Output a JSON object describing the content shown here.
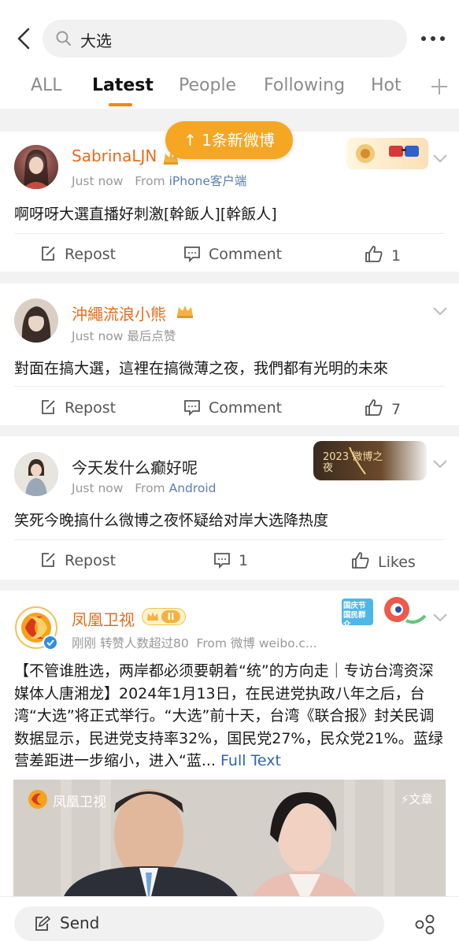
{
  "search": {
    "query": "大选"
  },
  "tabs": [
    {
      "label": "ALL"
    },
    {
      "label": "Latest"
    },
    {
      "label": "People"
    },
    {
      "label": "Following"
    },
    {
      "label": "Hot"
    }
  ],
  "new_posts_pill": "1条新微博",
  "posts": [
    {
      "username": "SabrinaLJN",
      "time": "Just now",
      "from_prefix": "From",
      "source": "iPhone客户端",
      "text": "啊呀呀大選直播好刺激[幹飯人][幹飯人]",
      "repost": "Repost",
      "comment": "Comment",
      "likes": "1"
    },
    {
      "username": "沖繩流浪小熊",
      "time": "Just now",
      "extra": "最后点赞",
      "text": "對面在搞大選，這裡在搞微薄之夜，我們都有光明的未來",
      "repost": "Repost",
      "comment": "Comment",
      "likes": "7"
    },
    {
      "username": "今天发什么癫好呢",
      "time": "Just now",
      "from_prefix": "From",
      "source": "Android",
      "banner_text": "2023 微博之夜",
      "text": "笑死今晚搞什么微博之夜怀疑给对岸大选降热度",
      "repost": "Repost",
      "comments": "1",
      "likes_label": "Likes"
    },
    {
      "username": "凤凰卫视",
      "level_badge": "II",
      "time": "刚刚",
      "extra": "转赞人数超过80",
      "from_prefix": "From",
      "source": "微博 weibo.c...",
      "badge_text": "国庆节 国民群众",
      "text": "【不管谁胜选，两岸都必须要朝着“统”的方向走｜专访台湾资深媒体人唐湘龙】2024年1月13日，在民进党执政八年之后，台湾“大选”将正式举行。“大选”前十天，台湾《联合报》封关民调数据显示，民进党支持率32%，国民党27%，民众党21%。蓝绿营差距进一步缩小，进入“蓝...",
      "full_text_link": "Full Text",
      "image_channel": "凤凰卫视",
      "image_tag": "文章"
    }
  ],
  "bottom": {
    "send_label": "Send"
  },
  "colors": {
    "accent": "#ff8200",
    "username": "#e86b1c",
    "link": "#5b7fb3",
    "pill": "#f5a623"
  }
}
